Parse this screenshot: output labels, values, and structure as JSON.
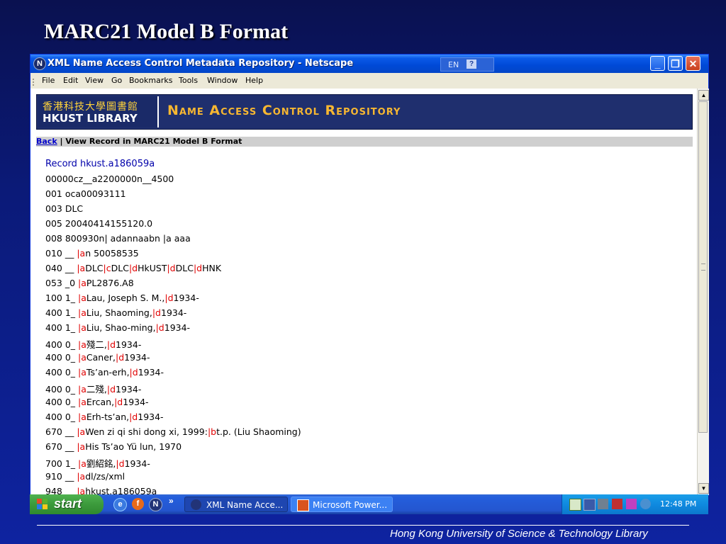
{
  "slide": {
    "title": "MARC21 Model B Format",
    "footer": "Hong Kong University of Science & Technology Library"
  },
  "window": {
    "title": "XML Name Access Control Metadata Repository - Netscape",
    "lang": "EN",
    "menu": [
      "File",
      "Edit",
      "View",
      "Go",
      "Bookmarks",
      "Tools",
      "Window",
      "Help"
    ]
  },
  "page": {
    "logo_zh": "香港科技大學圖書館",
    "logo_en": "HKUST LIBRARY",
    "heading": "Name Access Control Repository",
    "back_link": "Back",
    "crumb": " | View Record in MARC21 Model B Format",
    "record_title": "Record hkust.a186059a",
    "rows": [
      [
        {
          "t": "00000cz__a2200000n__4500"
        }
      ],
      [
        {
          "t": "001 oca00093111"
        }
      ],
      [
        {
          "t": "003 DLC"
        }
      ],
      [
        {
          "t": "005 20040414155120.0"
        }
      ],
      [
        {
          "t": "008 800930n| adannaabn |a aaa"
        }
      ],
      [
        {
          "t": "010 __ "
        },
        {
          "t": "|a",
          "s": true
        },
        {
          "t": "n 50058535"
        }
      ],
      [
        {
          "t": "040 __ "
        },
        {
          "t": "|a",
          "s": true
        },
        {
          "t": "DLC"
        },
        {
          "t": "|c",
          "s": true
        },
        {
          "t": "DLC"
        },
        {
          "t": "|d",
          "s": true
        },
        {
          "t": "HkUST"
        },
        {
          "t": "|d",
          "s": true
        },
        {
          "t": "DLC"
        },
        {
          "t": "|d",
          "s": true
        },
        {
          "t": "HNK"
        }
      ],
      [
        {
          "t": "053 _0 "
        },
        {
          "t": "|a",
          "s": true
        },
        {
          "t": "PL2876.A8"
        }
      ],
      [
        {
          "t": "100 1_ "
        },
        {
          "t": "|a",
          "s": true
        },
        {
          "t": "Lau, Joseph S. M.,"
        },
        {
          "t": "|d",
          "s": true
        },
        {
          "t": "1934-"
        }
      ],
      [
        {
          "t": "400 1_ "
        },
        {
          "t": "|a",
          "s": true
        },
        {
          "t": "Liu, Shaoming,"
        },
        {
          "t": "|d",
          "s": true
        },
        {
          "t": "1934-"
        }
      ],
      [
        {
          "t": "400 1_ "
        },
        {
          "t": "|a",
          "s": true
        },
        {
          "t": "Liu, Shao-ming,"
        },
        {
          "t": "|d",
          "s": true
        },
        {
          "t": "1934-"
        }
      ],
      [
        {
          "t": "400 0_ "
        },
        {
          "t": "|a",
          "s": true
        },
        {
          "t": "殘二,"
        },
        {
          "t": "|d",
          "s": true
        },
        {
          "t": "1934-"
        }
      ],
      [
        {
          "t": "400 0_ "
        },
        {
          "t": "|a",
          "s": true
        },
        {
          "t": "Caner,"
        },
        {
          "t": "|d",
          "s": true
        },
        {
          "t": "1934-"
        }
      ],
      [
        {
          "t": "400 0_ "
        },
        {
          "t": "|a",
          "s": true
        },
        {
          "t": "Ts’an-erh,"
        },
        {
          "t": "|d",
          "s": true
        },
        {
          "t": "1934-"
        }
      ],
      [
        {
          "t": "400 0_ "
        },
        {
          "t": "|a",
          "s": true
        },
        {
          "t": "二殘,"
        },
        {
          "t": "|d",
          "s": true
        },
        {
          "t": "1934-"
        }
      ],
      [
        {
          "t": "400 0_ "
        },
        {
          "t": "|a",
          "s": true
        },
        {
          "t": "Ercan,"
        },
        {
          "t": "|d",
          "s": true
        },
        {
          "t": "1934-"
        }
      ],
      [
        {
          "t": "400 0_ "
        },
        {
          "t": "|a",
          "s": true
        },
        {
          "t": "Erh-ts’an,"
        },
        {
          "t": "|d",
          "s": true
        },
        {
          "t": "1934-"
        }
      ],
      [
        {
          "t": "670 __ "
        },
        {
          "t": "|a",
          "s": true
        },
        {
          "t": "Wen zi qi shi dong xi, 1999:"
        },
        {
          "t": "|b",
          "s": true
        },
        {
          "t": "t.p. (Liu Shaoming)"
        }
      ],
      [
        {
          "t": "670 __ "
        },
        {
          "t": "|a",
          "s": true
        },
        {
          "t": "His Ts’ao Yü lun, 1970"
        }
      ],
      [
        {
          "t": "700 1_ "
        },
        {
          "t": "|a",
          "s": true
        },
        {
          "t": "劉紹銘,"
        },
        {
          "t": "|d",
          "s": true
        },
        {
          "t": "1934-"
        }
      ],
      [
        {
          "t": "910 __ "
        },
        {
          "t": "|a",
          "s": true
        },
        {
          "t": "dl/zs/xml"
        }
      ],
      [
        {
          "t": "948 __ "
        },
        {
          "t": "|a",
          "s": true
        },
        {
          "t": "hkust.a186059a"
        }
      ]
    ]
  },
  "taskbar": {
    "start": "start",
    "tasks": [
      "XML Name Acce...",
      "Microsoft Power..."
    ],
    "clock": "12:48 PM"
  },
  "colors": {
    "subfield": "#e00000",
    "banner_heading": "#f7b731",
    "record_title": "#0000aa"
  }
}
